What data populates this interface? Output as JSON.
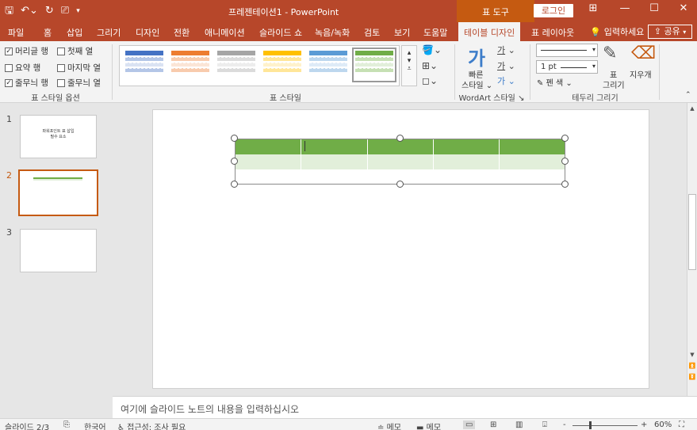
{
  "title_bar": {
    "document_title": "프레젠테이션1  -  PowerPoint",
    "context_tab_group": "표 도구",
    "login_label": "로그인",
    "qat_icons": [
      "save-icon",
      "undo-icon",
      "redo-icon",
      "present-icon",
      "customize-icon"
    ],
    "window_controls": [
      "ribbon-display-icon",
      "minimize-icon",
      "maximize-icon",
      "close-icon"
    ]
  },
  "tabs": [
    "파일",
    "홈",
    "삽입",
    "그리기",
    "디자인",
    "전환",
    "애니메이션",
    "슬라이드 쇼",
    "녹음/녹화",
    "검토",
    "보기",
    "도움말",
    "테이블 디자인",
    "표 레이아웃"
  ],
  "active_tab": "테이블 디자인",
  "tell_me": "입력하세요",
  "share_label": "공유",
  "ribbon": {
    "table_style_options": {
      "label": "표 스타일 옵션",
      "items": [
        {
          "label": "머리글 행",
          "checked": true
        },
        {
          "label": "첫째 열",
          "checked": false
        },
        {
          "label": "요약 행",
          "checked": false
        },
        {
          "label": "마지막 열",
          "checked": false
        },
        {
          "label": "줄무늬 행",
          "checked": true
        },
        {
          "label": "줄무늬 열",
          "checked": false
        }
      ]
    },
    "table_styles": {
      "label": "표 스타일",
      "swatches": [
        "#4472c4",
        "#ed7d31",
        "#a5a5a5",
        "#ffc000",
        "#5b9bd5",
        "#70ad47"
      ],
      "selected_index": 5
    },
    "wordart": {
      "label": "WordArt 스타일",
      "quick_styles_line1": "빠른",
      "quick_styles_line2": "스타일"
    },
    "borders": {
      "label": "테두리 그리기",
      "pen_weight": "1 pt",
      "pen_color": "펜 색",
      "draw_table_line1": "표",
      "draw_table_line2": "그리기",
      "eraser": "지우개"
    }
  },
  "slides": [
    {
      "number": "1",
      "text": "파워포인트 표 삽입\n필수 요소"
    },
    {
      "number": "2",
      "text": ""
    },
    {
      "number": "3",
      "text": ""
    }
  ],
  "active_slide": "2",
  "notes_placeholder": "여기에 슬라이드 노트의 내용을 입력하십시오",
  "status_bar": {
    "slide_info": "슬라이드 2/3",
    "language": "한국어",
    "accessibility": "접근성: 조사 필요",
    "notes_label": "메모",
    "comments_label": "메모",
    "zoom_minus": "-",
    "zoom_plus": "+",
    "zoom": "60%"
  },
  "colors": {
    "accent": "#b7472a",
    "table_tools": "#c55a11",
    "table_header": "#70ad47",
    "table_band": "#e2efda"
  }
}
